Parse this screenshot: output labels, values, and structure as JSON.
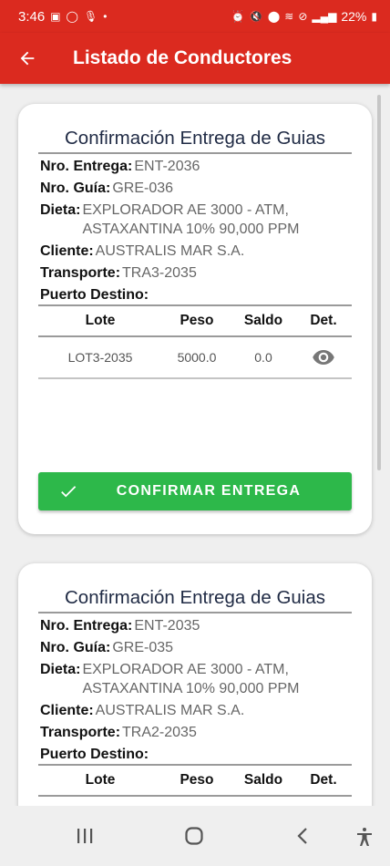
{
  "status_bar": {
    "time": "3:46",
    "battery": "22%"
  },
  "app_bar": {
    "title": "Listado de Conductores"
  },
  "cards": [
    {
      "title": "Confirmación Entrega de Guias",
      "nro_entrega": {
        "label": "Nro. Entrega:",
        "value": "ENT-2036"
      },
      "nro_guia": {
        "label": "Nro. Guía:",
        "value": "GRE-036"
      },
      "dieta": {
        "label": "Dieta:",
        "value": "EXPLORADOR AE 3000 - ATM, ASTAXANTINA 10% 90,000 PPM"
      },
      "cliente": {
        "label": "Cliente:",
        "value": "AUSTRALIS MAR S.A."
      },
      "transporte": {
        "label": "Transporte:",
        "value": "TRA3-2035"
      },
      "puerto": {
        "label": "Puerto Destino:",
        "value": ""
      },
      "table": {
        "headers": [
          "Lote",
          "Peso",
          "Saldo",
          "Det."
        ],
        "rows": [
          {
            "lote": "LOT3-2035",
            "peso": "5000.0",
            "saldo": "0.0"
          }
        ]
      },
      "button_label": "CONFIRMAR ENTREGA"
    },
    {
      "title": "Confirmación Entrega de Guias",
      "nro_entrega": {
        "label": "Nro. Entrega:",
        "value": "ENT-2035"
      },
      "nro_guia": {
        "label": "Nro. Guía:",
        "value": "GRE-035"
      },
      "dieta": {
        "label": "Dieta:",
        "value": "EXPLORADOR AE 3000 - ATM, ASTAXANTINA 10% 90,000 PPM"
      },
      "cliente": {
        "label": "Cliente:",
        "value": "AUSTRALIS MAR S.A."
      },
      "transporte": {
        "label": "Transporte:",
        "value": "TRA2-2035"
      },
      "puerto": {
        "label": "Puerto Destino:",
        "value": ""
      },
      "table": {
        "headers": [
          "Lote",
          "Peso",
          "Saldo",
          "Det."
        ]
      }
    }
  ],
  "icons": {
    "back": "arrow-left-icon",
    "view": "eye-icon",
    "check": "check-icon",
    "recents": "recents-icon",
    "home": "home-icon",
    "back_nav": "chevron-left-icon",
    "accessibility": "accessibility-icon"
  },
  "colors": {
    "primary": "#db2a1f",
    "success": "#2db84a",
    "title_text": "#1f2a44"
  }
}
